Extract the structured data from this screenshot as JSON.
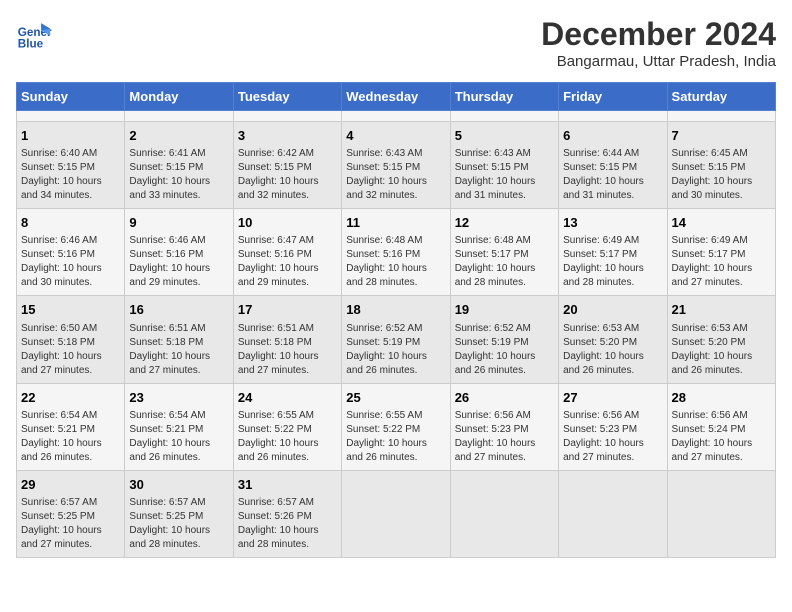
{
  "header": {
    "logo_line1": "General",
    "logo_line2": "Blue",
    "title": "December 2024",
    "subtitle": "Bangarmau, Uttar Pradesh, India"
  },
  "calendar": {
    "days_of_week": [
      "Sunday",
      "Monday",
      "Tuesday",
      "Wednesday",
      "Thursday",
      "Friday",
      "Saturday"
    ],
    "weeks": [
      [
        {
          "day": "",
          "info": ""
        },
        {
          "day": "",
          "info": ""
        },
        {
          "day": "",
          "info": ""
        },
        {
          "day": "",
          "info": ""
        },
        {
          "day": "",
          "info": ""
        },
        {
          "day": "",
          "info": ""
        },
        {
          "day": "",
          "info": ""
        }
      ],
      [
        {
          "day": "1",
          "info": "Sunrise: 6:40 AM\nSunset: 5:15 PM\nDaylight: 10 hours\nand 34 minutes."
        },
        {
          "day": "2",
          "info": "Sunrise: 6:41 AM\nSunset: 5:15 PM\nDaylight: 10 hours\nand 33 minutes."
        },
        {
          "day": "3",
          "info": "Sunrise: 6:42 AM\nSunset: 5:15 PM\nDaylight: 10 hours\nand 32 minutes."
        },
        {
          "day": "4",
          "info": "Sunrise: 6:43 AM\nSunset: 5:15 PM\nDaylight: 10 hours\nand 32 minutes."
        },
        {
          "day": "5",
          "info": "Sunrise: 6:43 AM\nSunset: 5:15 PM\nDaylight: 10 hours\nand 31 minutes."
        },
        {
          "day": "6",
          "info": "Sunrise: 6:44 AM\nSunset: 5:15 PM\nDaylight: 10 hours\nand 31 minutes."
        },
        {
          "day": "7",
          "info": "Sunrise: 6:45 AM\nSunset: 5:15 PM\nDaylight: 10 hours\nand 30 minutes."
        }
      ],
      [
        {
          "day": "8",
          "info": "Sunrise: 6:46 AM\nSunset: 5:16 PM\nDaylight: 10 hours\nand 30 minutes."
        },
        {
          "day": "9",
          "info": "Sunrise: 6:46 AM\nSunset: 5:16 PM\nDaylight: 10 hours\nand 29 minutes."
        },
        {
          "day": "10",
          "info": "Sunrise: 6:47 AM\nSunset: 5:16 PM\nDaylight: 10 hours\nand 29 minutes."
        },
        {
          "day": "11",
          "info": "Sunrise: 6:48 AM\nSunset: 5:16 PM\nDaylight: 10 hours\nand 28 minutes."
        },
        {
          "day": "12",
          "info": "Sunrise: 6:48 AM\nSunset: 5:17 PM\nDaylight: 10 hours\nand 28 minutes."
        },
        {
          "day": "13",
          "info": "Sunrise: 6:49 AM\nSunset: 5:17 PM\nDaylight: 10 hours\nand 28 minutes."
        },
        {
          "day": "14",
          "info": "Sunrise: 6:49 AM\nSunset: 5:17 PM\nDaylight: 10 hours\nand 27 minutes."
        }
      ],
      [
        {
          "day": "15",
          "info": "Sunrise: 6:50 AM\nSunset: 5:18 PM\nDaylight: 10 hours\nand 27 minutes."
        },
        {
          "day": "16",
          "info": "Sunrise: 6:51 AM\nSunset: 5:18 PM\nDaylight: 10 hours\nand 27 minutes."
        },
        {
          "day": "17",
          "info": "Sunrise: 6:51 AM\nSunset: 5:18 PM\nDaylight: 10 hours\nand 27 minutes."
        },
        {
          "day": "18",
          "info": "Sunrise: 6:52 AM\nSunset: 5:19 PM\nDaylight: 10 hours\nand 26 minutes."
        },
        {
          "day": "19",
          "info": "Sunrise: 6:52 AM\nSunset: 5:19 PM\nDaylight: 10 hours\nand 26 minutes."
        },
        {
          "day": "20",
          "info": "Sunrise: 6:53 AM\nSunset: 5:20 PM\nDaylight: 10 hours\nand 26 minutes."
        },
        {
          "day": "21",
          "info": "Sunrise: 6:53 AM\nSunset: 5:20 PM\nDaylight: 10 hours\nand 26 minutes."
        }
      ],
      [
        {
          "day": "22",
          "info": "Sunrise: 6:54 AM\nSunset: 5:21 PM\nDaylight: 10 hours\nand 26 minutes."
        },
        {
          "day": "23",
          "info": "Sunrise: 6:54 AM\nSunset: 5:21 PM\nDaylight: 10 hours\nand 26 minutes."
        },
        {
          "day": "24",
          "info": "Sunrise: 6:55 AM\nSunset: 5:22 PM\nDaylight: 10 hours\nand 26 minutes."
        },
        {
          "day": "25",
          "info": "Sunrise: 6:55 AM\nSunset: 5:22 PM\nDaylight: 10 hours\nand 26 minutes."
        },
        {
          "day": "26",
          "info": "Sunrise: 6:56 AM\nSunset: 5:23 PM\nDaylight: 10 hours\nand 27 minutes."
        },
        {
          "day": "27",
          "info": "Sunrise: 6:56 AM\nSunset: 5:23 PM\nDaylight: 10 hours\nand 27 minutes."
        },
        {
          "day": "28",
          "info": "Sunrise: 6:56 AM\nSunset: 5:24 PM\nDaylight: 10 hours\nand 27 minutes."
        }
      ],
      [
        {
          "day": "29",
          "info": "Sunrise: 6:57 AM\nSunset: 5:25 PM\nDaylight: 10 hours\nand 27 minutes."
        },
        {
          "day": "30",
          "info": "Sunrise: 6:57 AM\nSunset: 5:25 PM\nDaylight: 10 hours\nand 28 minutes."
        },
        {
          "day": "31",
          "info": "Sunrise: 6:57 AM\nSunset: 5:26 PM\nDaylight: 10 hours\nand 28 minutes."
        },
        {
          "day": "",
          "info": ""
        },
        {
          "day": "",
          "info": ""
        },
        {
          "day": "",
          "info": ""
        },
        {
          "day": "",
          "info": ""
        }
      ]
    ]
  }
}
